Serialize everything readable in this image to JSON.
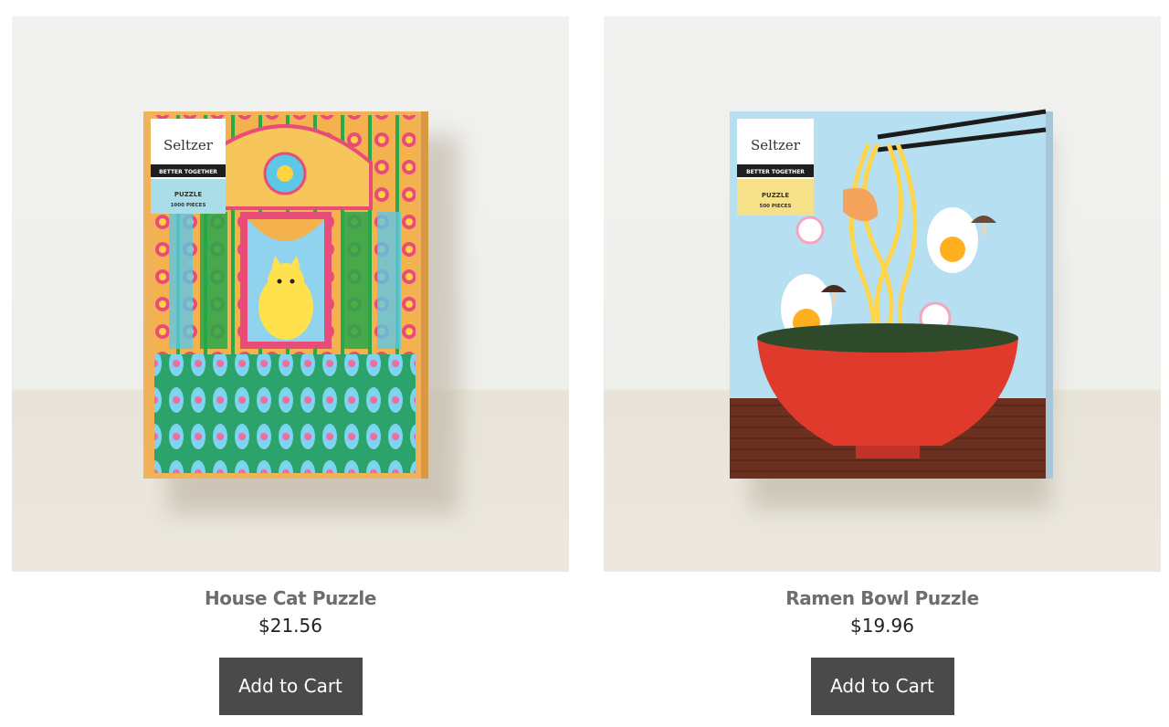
{
  "products": [
    {
      "name": "House Cat Puzzle",
      "price": "$21.56",
      "cta": "Add to Cart",
      "box": {
        "brand": "Seltzer",
        "tagline": "BETTER TOGETHER",
        "type": "PUZZLE",
        "pieces": "1000 PIECES"
      }
    },
    {
      "name": "Ramen Bowl Puzzle",
      "price": "$19.96",
      "cta": "Add to Cart",
      "box": {
        "brand": "Seltzer",
        "tagline": "BETTER TOGETHER",
        "type": "PUZZLE",
        "pieces": "500 PIECES"
      }
    }
  ],
  "colors": {
    "button_bg": "#4a4a4a",
    "title_text": "#6d6d6d",
    "price_text": "#222222"
  }
}
